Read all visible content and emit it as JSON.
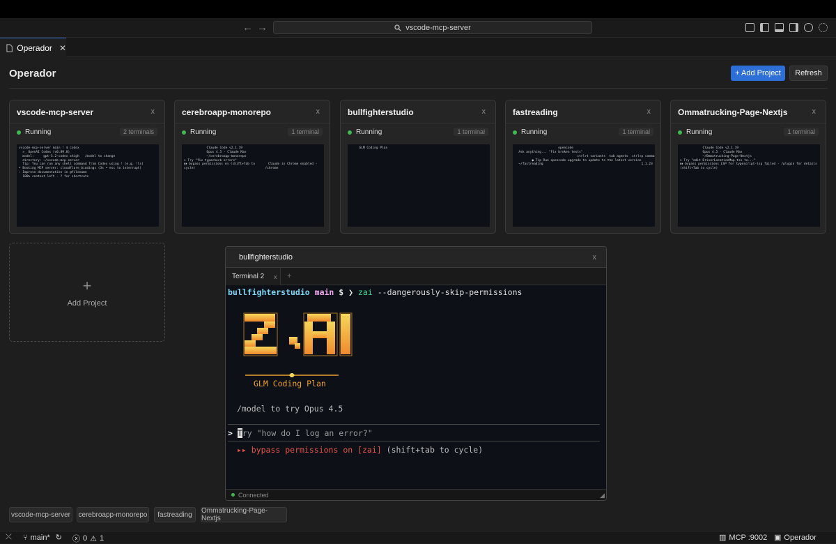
{
  "titlebar": {
    "search_text": "vscode-mcp-server"
  },
  "tab": {
    "label": "Operador"
  },
  "header": {
    "title": "Operador",
    "add_label": "+ Add Project",
    "refresh_label": "Refresh"
  },
  "cards": [
    {
      "name": "vscode-mcp-server",
      "status": "Running",
      "badge": "2 terminals",
      "preview": [
        "vscode-mcp-server main ! $ codex",
        "",
        "  >_ OpenAI Codex (v0.89.0)",
        "",
        "  model:     gpt-5.2-codex xhigh   /model to change",
        "  directory: ~/vscode-mcp-server",
        "",
        "  Tip: You can run any shell command from Codex using ! (e.g. !ls)",
        "",
        "• Booting MCP server: cloudflare_bindings (3s • esc to interrupt)",
        "",
        "› Improve documentation in @filename",
        "",
        "  100% context left · ? for shortcuts"
      ]
    },
    {
      "name": "cerebroapp-monorepo",
      "status": "Running",
      "badge": "1 terminal",
      "preview": [
        "",
        "",
        "",
        "",
        "",
        "            Claude Code v2.1.19",
        "            Opus 4.5 · Claude Max",
        "            ~/cerebroapp-monorepo",
        "",
        "> Try \"fix typecheck errors\"",
        "",
        "⏵⏵ bypass permissions on (shift+Tab to       Claude in Chrome enabled ·",
        "cycle)                                     /chrome"
      ]
    },
    {
      "name": "bullfighterstudio",
      "status": "Running",
      "badge": "1 terminal",
      "preview": [
        "",
        "",
        "",
        "",
        "",
        "",
        "",
        "",
        "",
        "     GLM Coding Plan"
      ]
    },
    {
      "name": "fastreading",
      "status": "Running",
      "badge": "1 terminal",
      "preview": [
        "",
        "",
        "",
        "",
        "",
        "",
        "",
        "",
        "",
        "                       opencode",
        "",
        "",
        "  Ask anything... \"Fix broken tests\"",
        "",
        "                                 ctrl+t variants  tab agents  ctrl+p commands",
        "",
        "",
        "         ● Tip Run opencode upgrade to update to the latest version",
        "  ~/fastreading                                                    1.1.23"
      ]
    },
    {
      "name": "Ommatrucking-Page-Nextjs",
      "status": "Running",
      "badge": "1 terminal",
      "preview": [
        "",
        "",
        "",
        "",
        "",
        "            Claude Code v2.1.19",
        "            Opus 4.5 · Claude Max",
        "            ~/Ommatrucking-Page-Nextjs",
        "",
        "> Try \"edit DriverLocationMap.tsx to...\"",
        "",
        "⏵⏵ bypass permissions LSP for typescript-lsp failed · /plugin for details",
        "(shift+Tab to cycle)"
      ]
    }
  ],
  "add_card": {
    "label": "Add Project",
    "plus": "+"
  },
  "terminal": {
    "title": "bullfighterstudio",
    "tab_label": "Terminal 2",
    "prompt_dir": "bullfighterstudio",
    "prompt_branch": "main",
    "prompt_symbol": "$ ❯",
    "cmd_name": "zai",
    "cmd_args": "--dangerously-skip-permissions",
    "logo_text": "Z.AI",
    "plan_label": "GLM Coding Plan",
    "tip": "/model to try Opus 4.5",
    "input_prompt": ">",
    "input_cursor": "T",
    "input_placeholder": "ry \"how do I log an error?\"",
    "bypass_prefix": "▸▸ bypass permissions on [zai]",
    "bypass_suffix": "(shift+tab to cycle)",
    "footer": "Connected"
  },
  "chips": [
    "vscode-mcp-server",
    "cerebroapp-monorepo",
    "fastreading",
    "Ommatrucking-Page-Nextjs"
  ],
  "statusbar": {
    "branch": "main*",
    "errors": "0",
    "warnings": "1",
    "mcp": "MCP :9002",
    "operador": "Operador"
  },
  "colors": {
    "accent": "#2d6fd6",
    "running": "#3fb950",
    "prompt_cyan": "#7fd6f5",
    "prompt_pink": "#f0a6f0",
    "bypass_red": "#e5534b",
    "zai_orange": "#f0a030"
  }
}
